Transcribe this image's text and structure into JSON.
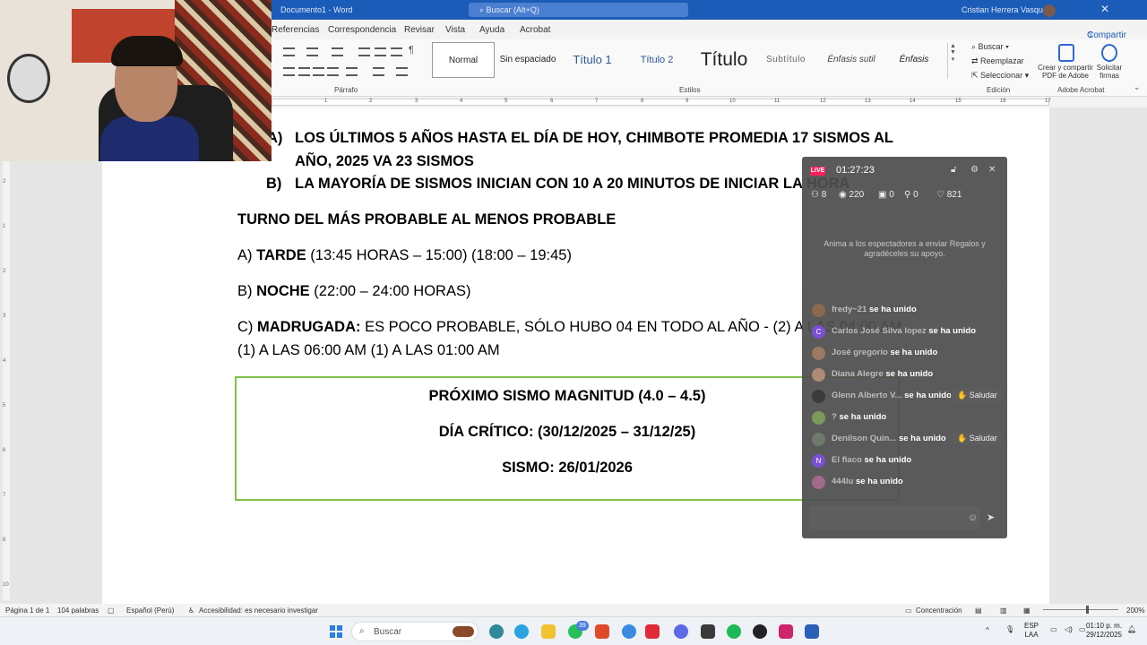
{
  "titlebar": {
    "doc_name": "Documento1 - Word",
    "search_placeholder": "Buscar (Alt+Q)",
    "user": "Cristian Herrera Vasquez"
  },
  "ribbon": {
    "tabs": [
      "Referencias",
      "Correspondencia",
      "Revisar",
      "Vista",
      "Ayuda",
      "Acrobat"
    ],
    "share_label": "Compartir",
    "group_paragraph": "Párrafo",
    "group_styles": "Estilos",
    "group_edit": "Edición",
    "group_adobe": "Adobe Acrobat",
    "styles": [
      "Normal",
      "Sin espaciado",
      "Título 1",
      "Título 2",
      "Título",
      "Subtítulo",
      "Énfasis sutil",
      "Énfasis"
    ],
    "edit_buscar": "Buscar",
    "edit_reemplazar": "Reemplazar",
    "edit_seleccionar": "Seleccionar",
    "adobe_crear": "Crear y compartir PDF de Adobe",
    "adobe_solicitar": "Solicitar firmas"
  },
  "ruler_numbers": [
    "1",
    "2",
    "3",
    "4",
    "5",
    "6",
    "7",
    "8",
    "9",
    "10",
    "11",
    "12",
    "13",
    "14",
    "15",
    "16",
    "17"
  ],
  "vruler_numbers": [
    "2",
    "1",
    "1",
    "2",
    "3",
    "4",
    "5",
    "6",
    "7",
    "8",
    "9",
    "10"
  ],
  "document": {
    "item_a_marker": "A)",
    "item_a_line1": "LOS ÚLTIMOS 5 AÑOS HASTA EL DÍA DE HOY, CHIMBOTE PROMEDIA 17 SISMOS AL",
    "item_a_line2": "AÑO, 2025 VA 23 SISMOS",
    "item_b_marker": "B)",
    "item_b_text": "LA MAYORÍA DE SISMOS INICIAN CON 10 A 20 MINUTOS DE INICIAR LA HORA",
    "heading": "TURNO DEL MÁS PROBABLE AL MENOS PROBABLE",
    "turn_a_prefix": "A) ",
    "turn_a_bold": "TARDE",
    "turn_a_rest": " (13:45 HORAS – 15:00) (18:00 – 19:45)",
    "turn_b_prefix": "B) ",
    "turn_b_bold": "NOCHE",
    "turn_b_rest": " (22:00 – 24:00 HORAS)",
    "turn_c_prefix": "C) ",
    "turn_c_bold": "MADRUGADA:",
    "turn_c_rest": " ES POCO PROBABLE, SÓLO HUBO 04 EN TODO AL AÑO - (2) A LAS 04:00 AM",
    "turn_c_line2": "(1) A LAS 06:00 AM (1) A LAS 01:00 AM",
    "box_line1": "PRÓXIMO SISMO MAGNITUD (4.0 – 4.5)",
    "box_line2": "DÍA CRÍTICO: (30/12/2025 – 31/12/25)",
    "box_line3": "SISMO: 26/01/2026"
  },
  "live": {
    "badge": "LIVE",
    "time": "01:27:23",
    "stats": [
      "8",
      "220",
      "0",
      "0",
      "821"
    ],
    "message": "Anima a los espectadores a enviar Regalos y agradéceles su apoyo.",
    "joined_label": "se ha unido",
    "greet_label": "Saludar",
    "chat": [
      {
        "name": "fredy~21",
        "avatar": "#8a6a50"
      },
      {
        "name": "Carlos José Silva lopez",
        "avatar": "#7a4fd6"
      },
      {
        "name": "José gregorio",
        "avatar": "#9a7a62"
      },
      {
        "name": "Diana Alegre",
        "avatar": "#b08a78"
      },
      {
        "name": "Glenn Alberto V...",
        "avatar": "#3b3b3b"
      },
      {
        "name": "?",
        "avatar": "#7c9a5a"
      },
      {
        "name": "Denilson Quin...",
        "avatar": "#6e7a6a"
      },
      {
        "name": "El flaco",
        "avatar": "#7a4fd6"
      },
      {
        "name": "444lu",
        "avatar": "#a26a8a"
      }
    ]
  },
  "statusbar": {
    "page": "Página 1 de 1",
    "words": "104 palabras",
    "language": "Español (Perú)",
    "accessibility": "Accesibilidad: es necesario investigar",
    "focus": "Concentración",
    "zoom": "200%"
  },
  "taskbar": {
    "search_label": "Buscar",
    "badge_count": "39",
    "lang_top": "ESP",
    "lang_bottom": "LAA",
    "time": "01:10 p. m.",
    "date": "29/12/2025"
  }
}
